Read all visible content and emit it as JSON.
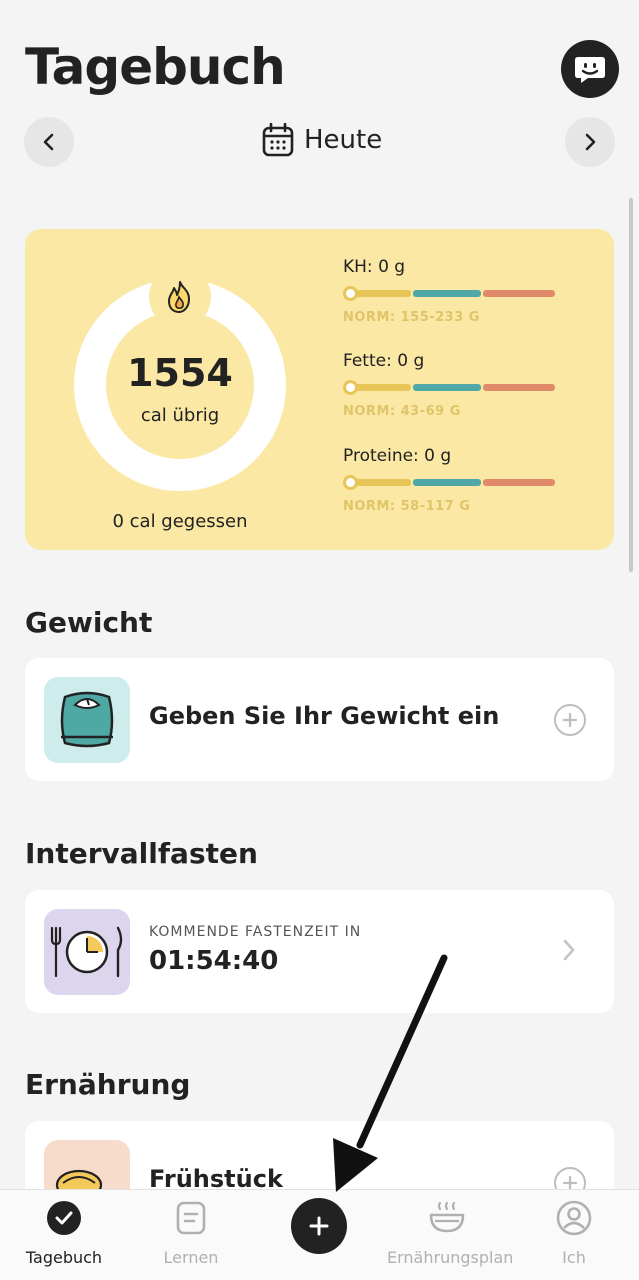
{
  "header": {
    "title": "Tagebuch",
    "date_label": "Heute"
  },
  "calories": {
    "remaining_value": "1554",
    "remaining_label": "cal übrig",
    "eaten_label": "0 cal gegessen",
    "macros": [
      {
        "label": "KH: 0 g",
        "norm": "NORM: 155-233 G",
        "progress": 0
      },
      {
        "label": "Fette: 0 g",
        "norm": "NORM: 43-69 G",
        "progress": 0
      },
      {
        "label": "Proteine: 0 g",
        "norm": "NORM: 58-117 G",
        "progress": 0
      }
    ]
  },
  "sections": {
    "weight": {
      "title": "Gewicht",
      "prompt": "Geben Sie Ihr Gewicht ein"
    },
    "fasting": {
      "title": "Intervallfasten",
      "label": "KOMMENDE FASTENZEIT IN",
      "time": "01:54:40"
    },
    "nutrition": {
      "title": "Ernährung",
      "meal": "Frühstück"
    }
  },
  "bottom_nav": {
    "items": [
      {
        "label": "Tagebuch",
        "icon": "check-circle-icon",
        "active": true
      },
      {
        "label": "Lernen",
        "icon": "document-icon",
        "active": false
      },
      {
        "label": "Ernährungsplan",
        "icon": "bowl-icon",
        "active": false
      },
      {
        "label": "Ich",
        "icon": "profile-icon",
        "active": false
      }
    ],
    "add_icon": "plus-icon"
  },
  "colors": {
    "card_yellow": "#fae8a4",
    "carbs": "#e8c557",
    "fat": "#4fa8a6",
    "protein": "#e08a69",
    "dark": "#222222"
  }
}
